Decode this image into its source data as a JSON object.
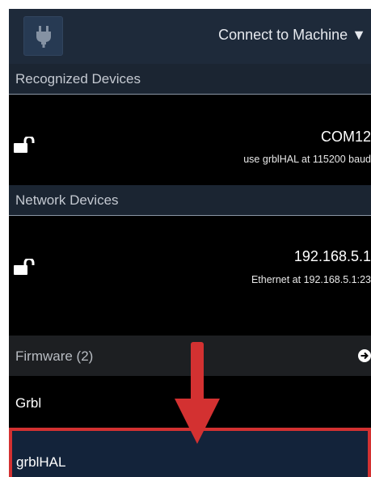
{
  "header": {
    "connect_label": "Connect to Machine ▼",
    "plug_icon": "plug-icon"
  },
  "recognized": {
    "title": "Recognized Devices",
    "devices": [
      {
        "name": "COM12",
        "detail": "use grblHAL at 115200 baud",
        "icon": "unlock-icon"
      }
    ]
  },
  "network": {
    "title": "Network Devices",
    "devices": [
      {
        "name": "192.168.5.1",
        "detail": "Ethernet at 192.168.5.1:23",
        "icon": "unlock-icon"
      }
    ]
  },
  "firmware": {
    "title": "Firmware (2)",
    "expand_icon": "arrow-right-circle-icon",
    "items": [
      {
        "label": "Grbl"
      },
      {
        "label": "grblHAL",
        "highlighted": true
      }
    ]
  },
  "annotation": {
    "arrow_icon": "red-down-arrow-icon",
    "color": "#d33131"
  },
  "colors": {
    "topbar": "#1e2a3a",
    "section_header": "#1b2532",
    "highlight_bg": "#13233a",
    "highlight_border": "#d33131"
  }
}
